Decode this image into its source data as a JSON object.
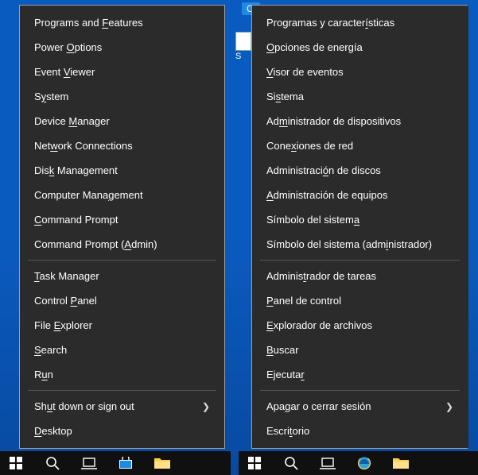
{
  "background_label": "Ci",
  "desktop_icon_letter": "S",
  "menus": {
    "left": {
      "groups": [
        [
          {
            "pre": "Programs and ",
            "u": "F",
            "post": "eatures",
            "key": "programs-and-features"
          },
          {
            "pre": "Power ",
            "u": "O",
            "post": "ptions",
            "key": "power-options"
          },
          {
            "pre": "Event ",
            "u": "V",
            "post": "iewer",
            "key": "event-viewer"
          },
          {
            "pre": "S",
            "u": "y",
            "post": "stem",
            "key": "system"
          },
          {
            "pre": "Device ",
            "u": "M",
            "post": "anager",
            "key": "device-manager"
          },
          {
            "pre": "Net",
            "u": "w",
            "post": "ork Connections",
            "key": "network-connections"
          },
          {
            "pre": "Dis",
            "u": "k",
            "post": " Management",
            "key": "disk-management"
          },
          {
            "pre": "Computer Mana",
            "u": "g",
            "post": "ement",
            "key": "computer-management"
          },
          {
            "pre": "",
            "u": "C",
            "post": "ommand Prompt",
            "key": "command-prompt"
          },
          {
            "pre": "Command Prompt (",
            "u": "A",
            "post": "dmin)",
            "key": "command-prompt-admin"
          }
        ],
        [
          {
            "pre": "",
            "u": "T",
            "post": "ask Manager",
            "key": "task-manager"
          },
          {
            "pre": "Control ",
            "u": "P",
            "post": "anel",
            "key": "control-panel"
          },
          {
            "pre": "File ",
            "u": "E",
            "post": "xplorer",
            "key": "file-explorer"
          },
          {
            "pre": "",
            "u": "S",
            "post": "earch",
            "key": "search"
          },
          {
            "pre": "R",
            "u": "u",
            "post": "n",
            "key": "run"
          }
        ],
        [
          {
            "pre": "Sh",
            "u": "u",
            "post": "t down or sign out",
            "key": "shut-down-or-sign-out",
            "submenu": true
          },
          {
            "pre": "",
            "u": "D",
            "post": "esktop",
            "key": "desktop"
          }
        ]
      ]
    },
    "right": {
      "groups": [
        [
          {
            "pre": "Programas y caracter",
            "u": "í",
            "post": "sticas",
            "key": "programas-y-caracteristicas"
          },
          {
            "pre": "",
            "u": "O",
            "post": "pciones de energía",
            "key": "opciones-de-energia"
          },
          {
            "pre": "",
            "u": "V",
            "post": "isor de eventos",
            "key": "visor-de-eventos"
          },
          {
            "pre": "Si",
            "u": "s",
            "post": "tema",
            "key": "sistema"
          },
          {
            "pre": "Ad",
            "u": "m",
            "post": "inistrador de dispositivos",
            "key": "administrador-de-dispositivos"
          },
          {
            "pre": "Cone",
            "u": "x",
            "post": "iones de red",
            "key": "conexiones-de-red"
          },
          {
            "pre": "Administraci",
            "u": "ó",
            "post": "n de discos",
            "key": "administracion-de-discos"
          },
          {
            "pre": "",
            "u": "A",
            "post": "dministración de equipos",
            "key": "administracion-de-equipos"
          },
          {
            "pre": "Símbolo del sistem",
            "u": "a",
            "post": "",
            "key": "simbolo-del-sistema"
          },
          {
            "pre": "Símbolo del sistema (adm",
            "u": "i",
            "post": "nistrador)",
            "key": "simbolo-del-sistema-admin"
          }
        ],
        [
          {
            "pre": "Adminis",
            "u": "t",
            "post": "rador de tareas",
            "key": "administrador-de-tareas"
          },
          {
            "pre": "",
            "u": "P",
            "post": "anel de control",
            "key": "panel-de-control"
          },
          {
            "pre": "",
            "u": "E",
            "post": "xplorador de archivos",
            "key": "explorador-de-archivos"
          },
          {
            "pre": "",
            "u": "B",
            "post": "uscar",
            "key": "buscar"
          },
          {
            "pre": "Ejecuta",
            "u": "r",
            "post": "",
            "key": "ejecutar"
          }
        ],
        [
          {
            "pre": "Apa",
            "u": "g",
            "post": "ar o cerrar sesión",
            "key": "apagar-o-cerrar-sesion",
            "submenu": true
          },
          {
            "pre": "Escri",
            "u": "t",
            "post": "orio",
            "key": "escritorio"
          }
        ]
      ]
    }
  },
  "taskbar_left_icons": [
    "start",
    "search",
    "task-view",
    "store",
    "file-explorer"
  ],
  "taskbar_right_icons": [
    "start",
    "search",
    "task-view",
    "internet-explorer",
    "file-explorer"
  ]
}
